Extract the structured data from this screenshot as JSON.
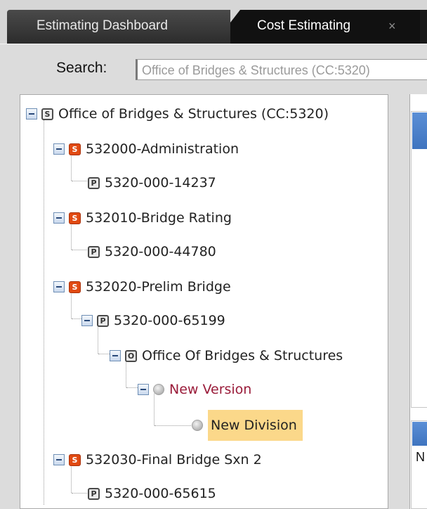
{
  "tabs": [
    {
      "label": "Estimating Dashboard",
      "active": false
    },
    {
      "label": "Cost Estimating",
      "active": true,
      "close_icon": "×"
    }
  ],
  "search": {
    "label": "Search:",
    "value": "Office of Bridges & Structures (CC:5320)"
  },
  "tree": {
    "root": {
      "badge": "S",
      "label": "Office of Bridges & Structures (CC:5320)"
    },
    "items": [
      {
        "badge": "S",
        "label": "532000-Administration"
      },
      {
        "badge": "P",
        "label": "5320-000-14237"
      },
      {
        "badge": "S",
        "label": "532010-Bridge Rating"
      },
      {
        "badge": "P",
        "label": "5320-000-44780"
      },
      {
        "badge": "S",
        "label": "532020-Prelim Bridge"
      },
      {
        "badge": "P",
        "label": "5320-000-65199"
      },
      {
        "badge": "O",
        "label": "Office Of Bridges & Structures"
      },
      {
        "badge": "",
        "label": "New Version"
      },
      {
        "badge": "",
        "label": "New Division"
      },
      {
        "badge": "S",
        "label": "532030-Final Bridge Sxn 2"
      },
      {
        "badge": "P",
        "label": "5320-000-65615"
      }
    ]
  },
  "right_panel": {
    "lower_text": "N"
  },
  "colors": {
    "accent_orange": "#e14a12",
    "selected_bg": "#fbd88a",
    "link_text": "#9a1c3a",
    "panel_header_blue": "#4a80cc"
  }
}
